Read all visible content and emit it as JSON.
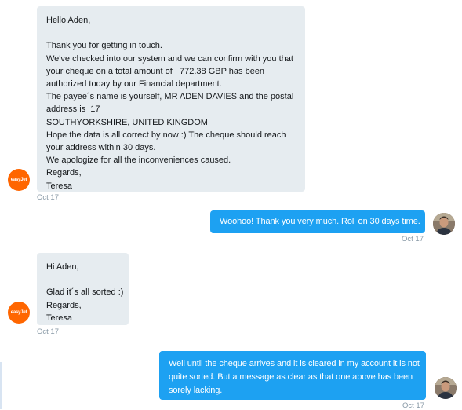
{
  "colors": {
    "incoming_bubble": "#e6ecf0",
    "outgoing_bubble": "#1da1f2",
    "brand_avatar": "#ff6600",
    "timestamp_text": "#8899a6"
  },
  "messages": [
    {
      "direction": "incoming",
      "lines": [
        "Hello Aden,",
        "",
        "Thank you for getting in touch.",
        "We've checked into our system and we can confirm with you that",
        "your cheque on a total amount of   772.38 GBP has been",
        "authorized today by our Financial department.",
        "The payee´s name is yourself, MR ADEN DAVIES and the postal",
        "address is  17",
        "SOUTHYORKSHIRE, UNITED KINGDOM",
        "Hope the data is all correct by now :) The cheque should reach",
        "your address within 30 days.",
        "We apologize for all the inconveniences caused.",
        "Regards,",
        "Teresa"
      ],
      "timestamp": "Oct 17",
      "avatar_label": "easyJet",
      "avatar_icon": "easyjet-logo"
    },
    {
      "direction": "outgoing",
      "lines": [
        "Woohoo! Thank you very much. Roll on 30 days time."
      ],
      "timestamp": "Oct 17",
      "avatar_icon": "user-photo"
    },
    {
      "direction": "incoming",
      "lines": [
        "Hi Aden,",
        "",
        "Glad it´s all sorted :)",
        "Regards,",
        "Teresa"
      ],
      "timestamp": "Oct 17",
      "avatar_label": "easyJet",
      "avatar_icon": "easyjet-logo"
    },
    {
      "direction": "outgoing",
      "lines": [
        "Well until the cheque arrives and it is cleared in my account it is not",
        "quite sorted. But a message as clear as that one above has been",
        "sorely lacking."
      ],
      "timestamp": "Oct 17",
      "avatar_icon": "user-photo"
    }
  ]
}
